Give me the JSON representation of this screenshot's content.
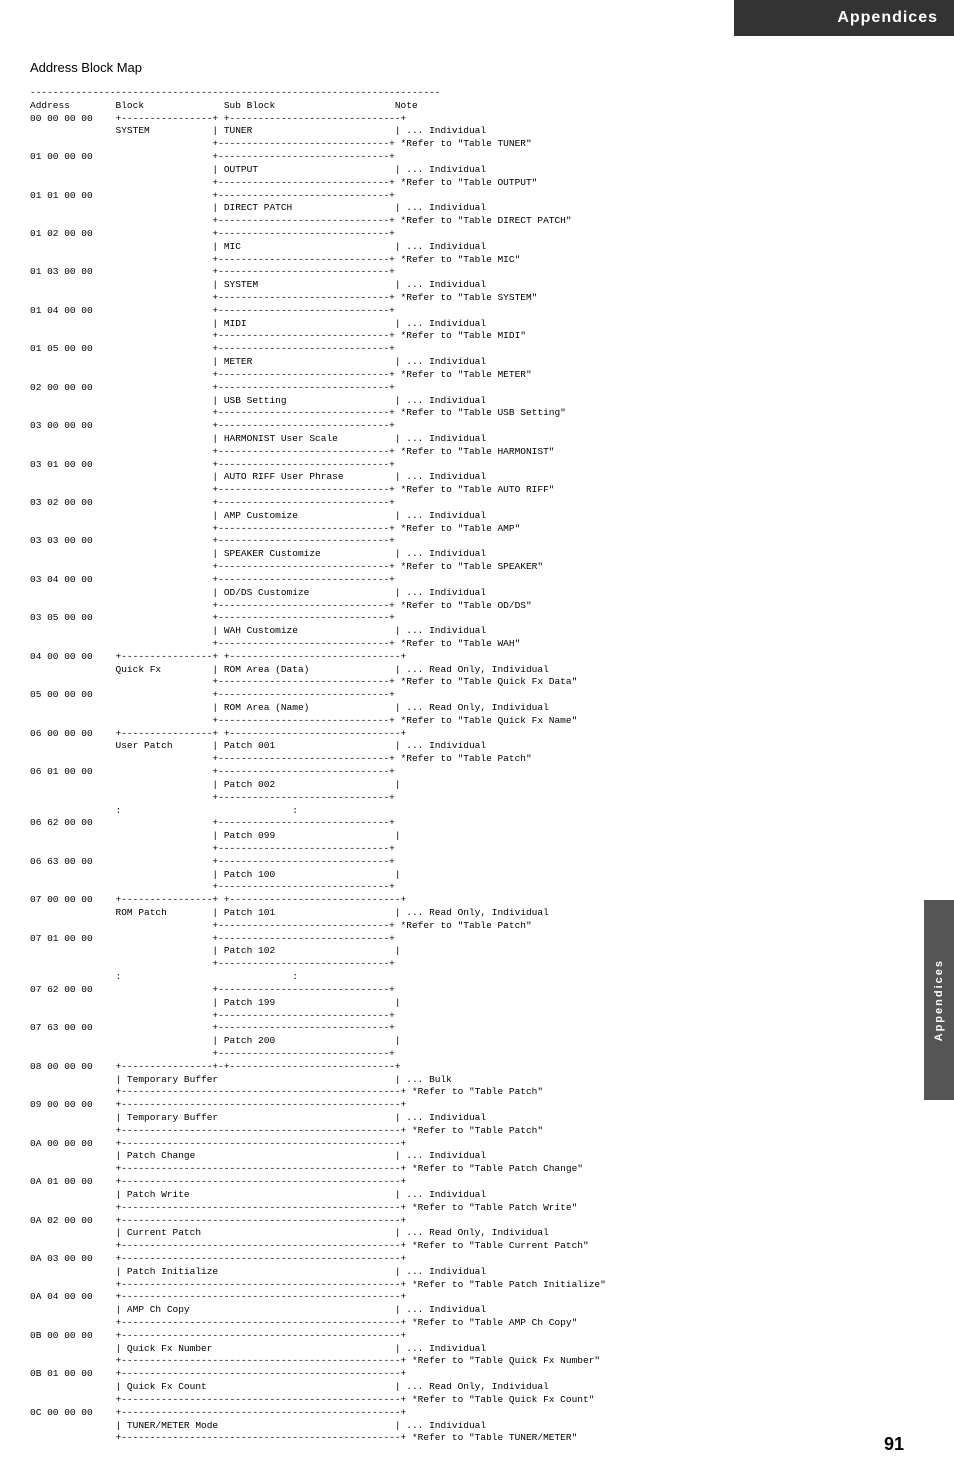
{
  "header": {
    "title": "Appendices"
  },
  "sidebar": {
    "label": "Appendices"
  },
  "page_number": "91",
  "section": {
    "title": "Address Block Map"
  },
  "table_content": "------------------------------------------------------------------------\nAddress        Block              Sub Block                     Note\n00 00 00 00    +----------------+ +------------------------------+\n               SYSTEM           | TUNER                         | ... Individual\n                                +------------------------------+ *Refer to \"Table TUNER\"\n01 00 00 00                     +------------------------------+\n                                | OUTPUT                        | ... Individual\n                                +------------------------------+ *Refer to \"Table OUTPUT\"\n01 01 00 00                     +------------------------------+\n                                | DIRECT PATCH                  | ... Individual\n                                +------------------------------+ *Refer to \"Table DIRECT PATCH\"\n01 02 00 00                     +------------------------------+\n                                | MIC                           | ... Individual\n                                +------------------------------+ *Refer to \"Table MIC\"\n01 03 00 00                     +------------------------------+\n                                | SYSTEM                        | ... Individual\n                                +------------------------------+ *Refer to \"Table SYSTEM\"\n01 04 00 00                     +------------------------------+\n                                | MIDI                          | ... Individual\n                                +------------------------------+ *Refer to \"Table MIDI\"\n01 05 00 00                     +------------------------------+\n                                | METER                         | ... Individual\n                                +------------------------------+ *Refer to \"Table METER\"\n02 00 00 00                     +------------------------------+\n                                | USB Setting                   | ... Individual\n                                +------------------------------+ *Refer to \"Table USB Setting\"\n03 00 00 00                     +------------------------------+\n                                | HARMONIST User Scale          | ... Individual\n                                +------------------------------+ *Refer to \"Table HARMONIST\"\n03 01 00 00                     +------------------------------+\n                                | AUTO RIFF User Phrase         | ... Individual\n                                +------------------------------+ *Refer to \"Table AUTO RIFF\"\n03 02 00 00                     +------------------------------+\n                                | AMP Customize                 | ... Individual\n                                +------------------------------+ *Refer to \"Table AMP\"\n03 03 00 00                     +------------------------------+\n                                | SPEAKER Customize             | ... Individual\n                                +------------------------------+ *Refer to \"Table SPEAKER\"\n03 04 00 00                     +------------------------------+\n                                | OD/DS Customize               | ... Individual\n                                +------------------------------+ *Refer to \"Table OD/DS\"\n03 05 00 00                     +------------------------------+\n                                | WAH Customize                 | ... Individual\n                                +------------------------------+ *Refer to \"Table WAH\"\n04 00 00 00    +----------------+ +------------------------------+\n               Quick Fx         | ROM Area (Data)               | ... Read Only, Individual\n                                +------------------------------+ *Refer to \"Table Quick Fx Data\"\n05 00 00 00                     +------------------------------+\n                                | ROM Area (Name)               | ... Read Only, Individual\n                                +------------------------------+ *Refer to \"Table Quick Fx Name\"\n06 00 00 00    +----------------+ +------------------------------+\n               User Patch       | Patch 001                     | ... Individual\n                                +------------------------------+ *Refer to \"Table Patch\"\n06 01 00 00                     +------------------------------+\n                                | Patch 002                     |\n                                +------------------------------+\n               :                              :\n06 62 00 00                     +------------------------------+\n                                | Patch 099                     |\n                                +------------------------------+\n06 63 00 00                     +------------------------------+\n                                | Patch 100                     |\n                                +------------------------------+\n07 00 00 00    +----------------+ +------------------------------+\n               ROM Patch        | Patch 101                     | ... Read Only, Individual\n                                +------------------------------+ *Refer to \"Table Patch\"\n07 01 00 00                     +------------------------------+\n                                | Patch 102                     |\n                                +------------------------------+\n               :                              :\n07 62 00 00                     +------------------------------+\n                                | Patch 199                     |\n                                +------------------------------+\n07 63 00 00                     +------------------------------+\n                                | Patch 200                     |\n                                +------------------------------+\n08 00 00 00    +----------------+-+-----------------------------+\n               | Temporary Buffer                               | ... Bulk\n               +-------------------------------------------------+ *Refer to \"Table Patch\"\n09 00 00 00    +-------------------------------------------------+\n               | Temporary Buffer                               | ... Individual\n               +-------------------------------------------------+ *Refer to \"Table Patch\"\n0A 00 00 00    +-------------------------------------------------+\n               | Patch Change                                   | ... Individual\n               +-------------------------------------------------+ *Refer to \"Table Patch Change\"\n0A 01 00 00    +-------------------------------------------------+\n               | Patch Write                                    | ... Individual\n               +-------------------------------------------------+ *Refer to \"Table Patch Write\"\n0A 02 00 00    +-------------------------------------------------+\n               | Current Patch                                  | ... Read Only, Individual\n               +-------------------------------------------------+ *Refer to \"Table Current Patch\"\n0A 03 00 00    +-------------------------------------------------+\n               | Patch Initialize                               | ... Individual\n               +-------------------------------------------------+ *Refer to \"Table Patch Initialize\"\n0A 04 00 00    +-------------------------------------------------+\n               | AMP Ch Copy                                    | ... Individual\n               +-------------------------------------------------+ *Refer to \"Table AMP Ch Copy\"\n0B 00 00 00    +-------------------------------------------------+\n               | Quick Fx Number                                | ... Individual\n               +-------------------------------------------------+ *Refer to \"Table Quick Fx Number\"\n0B 01 00 00    +-------------------------------------------------+\n               | Quick Fx Count                                 | ... Read Only, Individual\n               +-------------------------------------------------+ *Refer to \"Table Quick Fx Count\"\n0C 00 00 00    +-------------------------------------------------+\n               | TUNER/METER Mode                               | ... Individual\n               +-------------------------------------------------+ *Refer to \"Table TUNER/METER\""
}
